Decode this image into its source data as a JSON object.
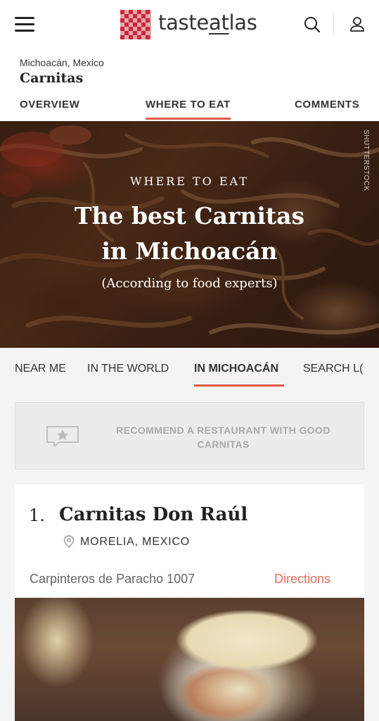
{
  "header": {
    "logo_text_pre": "taste",
    "logo_text_u": "at",
    "logo_text_post": "las",
    "icons": [
      "menu-icon",
      "search-icon",
      "user-icon"
    ]
  },
  "titlebar": {
    "location": "Michoacán, Mexico",
    "dish": "Carnitas",
    "tabs": [
      {
        "label": "OVERVIEW"
      },
      {
        "label": "WHERE TO EAT"
      },
      {
        "label": "COMMENTS"
      }
    ],
    "active_tab": "WHERE TO EAT"
  },
  "hero": {
    "kicker": "WHERE TO EAT",
    "title_line1": "The best Carnitas",
    "title_line2": "in Michoacán",
    "subtitle": "(According to food experts)",
    "credit": "SHUTTERSTOCK"
  },
  "subtabs": {
    "items": [
      {
        "label": "NEAR ME"
      },
      {
        "label": "IN THE WORLD"
      },
      {
        "label": "IN MICHOACÁN"
      },
      {
        "label": "SEARCH L("
      }
    ],
    "active": "IN MICHOACÁN"
  },
  "recommend": {
    "line1": "RECOMMEND A RESTAURANT WITH GOOD",
    "line2": "CARNITAS"
  },
  "card": {
    "rank": "1.",
    "name": "Carnitas Don Raúl",
    "city": "MORELIA, MEXICO",
    "address": "Carpinteros de Paracho 1007",
    "directions": "Directions"
  },
  "colors": {
    "accent": "#e05a4b",
    "logo_red": "#c8283a",
    "directions": "#e86d5d"
  }
}
